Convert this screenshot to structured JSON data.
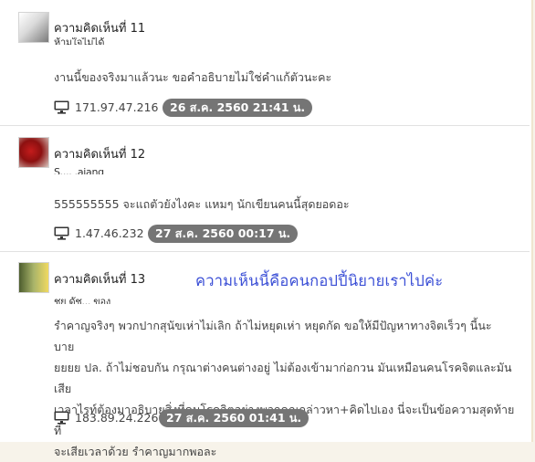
{
  "comments": [
    {
      "title": "ความคิดเห็นที่ 11",
      "author": "ห้ามใจไม่ได้",
      "body": "งานนี้ของจริงมาแล้วนะ ขอคำอธิบายไม่ใช่คำแก้ตัวนะคะ",
      "ip": "171.97.47.216",
      "date": "26 ส.ค. 2560 21:41 น."
    },
    {
      "title": "ความคิดเห็นที่ 12",
      "author": "S.... .ajang",
      "body": "555555555 จะแถตัวยังไงคะ แหมๆ นักเขียนคนนี้สุดยอดอะ",
      "ip": "1.47.46.232",
      "date": "27 ส.ค. 2560 00:17 น."
    },
    {
      "title": "ความคิดเห็นที่ 13",
      "author": "ชย ดัช... ของ",
      "body": [
        "รำคาญจริงๆ พวกปากสุนัขเห่าไม่เลิก ถ้าไม่หยุดเห่า หยุดกัด ขอให้มีปัญหาทางจิตเร็วๆ นี้นะ บาย",
        "ยยยย ปล. ถ้าไม่ชอบกัน กรุณาต่างคนต่างอยู่ ไม่ต้องเข้ามาก่อกวน มันเหมือนคนโรคจิตและมันเสีย",
        "เวลาไรท์ต้องมาอธิบายสิ่งที่คนโรคจิตอย่างพวกคุณกล่าวหา+คิดไปเอง นี่จะเป็นข้อความสุดท้ายที่",
        "จะเสียเวลาด้วย รำคาญมากพอละ"
      ],
      "ip": "183.89.24.226",
      "date": "27 ส.ค. 2560 01:41 น."
    }
  ],
  "annotation": "ความเห็นนี้คือคนกอปปี้นิยายเราไปค่ะ",
  "icons": {
    "ip": "monitor-icon"
  },
  "colors": {
    "annotation": "#3b4fd6",
    "date_badge": "#757575"
  }
}
